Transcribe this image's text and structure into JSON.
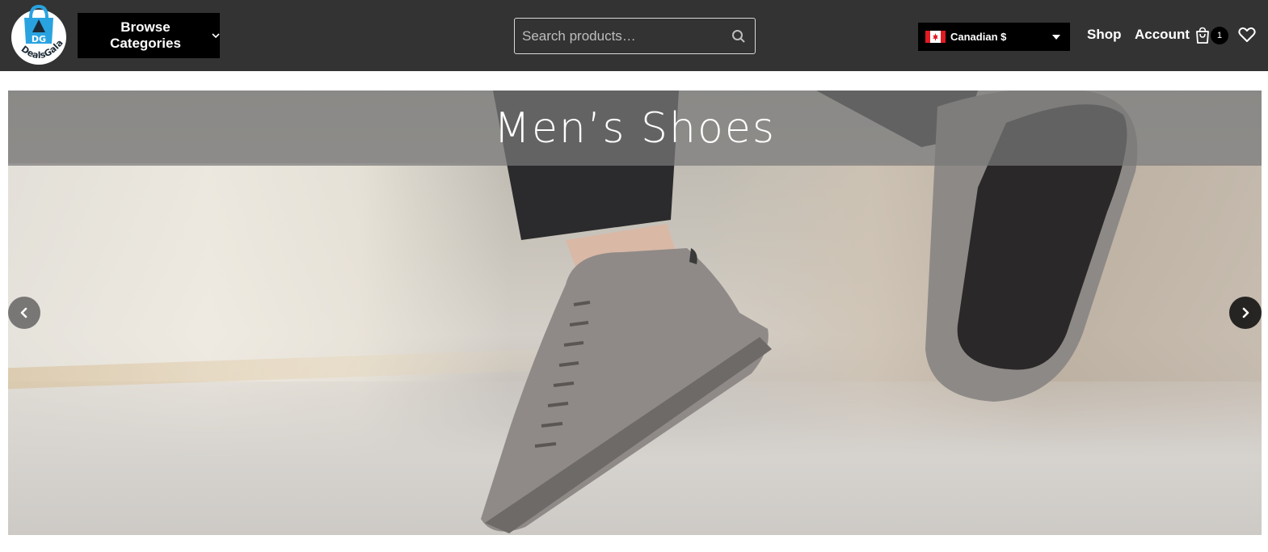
{
  "header": {
    "logo_text": "DealsGala",
    "logo_initials": "DG",
    "browse_label": "Browse Categories",
    "search_placeholder": "Search products…",
    "currency": {
      "label": "Canadian $",
      "flag_icon": "canada-flag-icon"
    },
    "nav": {
      "shop": "Shop",
      "account": "Account"
    },
    "cart_count": "1",
    "colors": {
      "header_bg": "#333333",
      "button_bg": "#000000",
      "logo_blue": "#29a3e0"
    }
  },
  "hero": {
    "title": "Men’s Shoes",
    "prev_icon": "chevron-left-icon",
    "next_icon": "chevron-right-icon"
  }
}
